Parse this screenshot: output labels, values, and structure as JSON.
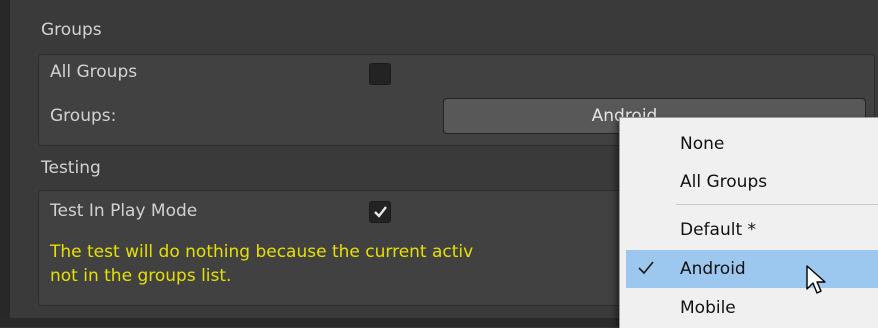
{
  "groups_section": {
    "title": "Groups",
    "all_groups_label": "All Groups",
    "all_groups_checked": false,
    "groups_label": "Groups:",
    "groups_value": "Android"
  },
  "testing_section": {
    "title": "Testing",
    "test_in_play_mode_label": "Test In Play Mode",
    "test_in_play_mode_checked": true,
    "warning_line1": "The test will do nothing because the current activ",
    "warning_line2": "not in the groups list."
  },
  "dropdown": {
    "items": [
      {
        "label": "None",
        "selected": false
      },
      {
        "label": "All Groups",
        "selected": false
      },
      {
        "label": "Default *",
        "selected": false
      },
      {
        "label": "Android",
        "selected": true
      },
      {
        "label": "Mobile",
        "selected": false
      }
    ]
  },
  "colors": {
    "background": "#383838",
    "warning_text": "#e6e000",
    "menu_highlight": "#9cc8ef"
  },
  "icons": [
    "checkmark-icon",
    "menu-checkmark-icon",
    "mouse-cursor-icon"
  ]
}
